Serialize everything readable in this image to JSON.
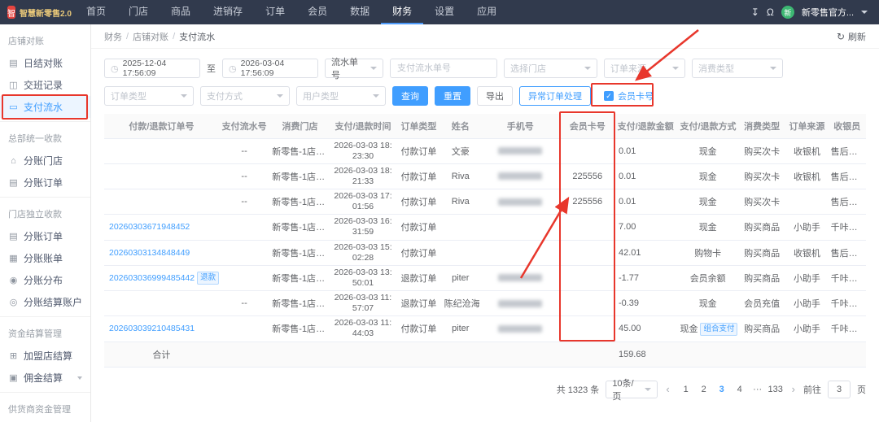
{
  "colors": {
    "accent": "#409eff",
    "topnav_bg": "#313a4d",
    "annotation": "#e8372c",
    "active_item_bg": "#ecf5ff"
  },
  "topnav": {
    "logo_text": "智慧新零售2.0",
    "items": [
      "首页",
      "门店",
      "商品",
      "进销存",
      "订单",
      "会员",
      "数据",
      "财务",
      "设置",
      "应用"
    ],
    "active": "财务",
    "avatar_text": "新",
    "user_name": "新零售官方..."
  },
  "sidebar": {
    "groups": [
      {
        "title": "店铺对账",
        "items": [
          {
            "label": "日结对账",
            "icon": "calendar-check-icon"
          },
          {
            "label": "交班记录",
            "icon": "shift-record-icon"
          },
          {
            "label": "支付流水",
            "icon": "payment-flow-icon",
            "active": true,
            "annotated": true
          }
        ]
      },
      {
        "title": "总部统一收款",
        "items": [
          {
            "label": "分账门店",
            "icon": "store-icon"
          },
          {
            "label": "分账订单",
            "icon": "order-icon"
          }
        ]
      },
      {
        "title": "门店独立收款",
        "items": [
          {
            "label": "分账订单",
            "icon": "order-icon"
          },
          {
            "label": "分账账单",
            "icon": "bill-icon"
          },
          {
            "label": "分账分布",
            "icon": "distribution-icon"
          },
          {
            "label": "分账结算账户",
            "icon": "account-icon"
          }
        ]
      },
      {
        "title": "资金结算管理",
        "items": [
          {
            "label": "加盟店结算",
            "icon": "franchise-icon"
          },
          {
            "label": "佣金结算",
            "icon": "commission-icon",
            "expandable": true
          }
        ]
      },
      {
        "title": "供货商资金管理",
        "items": []
      }
    ]
  },
  "breadcrumb": {
    "parts": [
      "财务",
      "店铺对账",
      "支付流水"
    ],
    "separator": "/",
    "refresh_label": "刷新"
  },
  "filters": {
    "date_from": "2025-12-04 17:56:09",
    "range_separator": "至",
    "date_to": "2026-03-04 17:56:09",
    "flow_no_select": "流水单号",
    "flow_no_placeholder": "支付流水单号",
    "store_placeholder": "选择门店",
    "order_source_placeholder": "订单来源",
    "consume_type_placeholder": "消费类型",
    "order_type_placeholder": "订单类型",
    "pay_method_placeholder": "支付方式",
    "user_type_placeholder": "用户类型",
    "search_label": "查询",
    "reset_label": "重置",
    "export_label": "导出",
    "abnormal_label": "异常订单处理",
    "member_card_label": "会员卡号",
    "member_card_checked": true
  },
  "table": {
    "columns": [
      "付款/退款订单号",
      "支付流水号",
      "消费门店",
      "支付/退款时间",
      "订单类型",
      "姓名",
      "手机号",
      "会员卡号",
      "支付/退款金额",
      "支付/退款方式",
      "消费类型",
      "订单来源",
      "收银员"
    ],
    "tags": {
      "refund": "退款"
    },
    "rows": [
      {
        "order": "",
        "link": false,
        "refund_tag": false,
        "flow": "--",
        "store": "新零售-1店（...",
        "time": "2026-03-03 18:23:30",
        "type": "付款订单",
        "name": "文豪",
        "phone_blurred": true,
        "card": "",
        "amount": "0.01",
        "method": "现金",
        "combo_tag": "",
        "consume": "购买次卡",
        "source": "收银机",
        "cashier": "售后小刘"
      },
      {
        "order": "",
        "link": false,
        "refund_tag": false,
        "flow": "--",
        "store": "新零售-1店（...",
        "time": "2026-03-03 18:21:33",
        "type": "付款订单",
        "name": "Riva",
        "phone_blurred": true,
        "card": "225556",
        "amount": "0.01",
        "method": "现金",
        "combo_tag": "",
        "consume": "购买次卡",
        "source": "收银机",
        "cashier": "售后小刘"
      },
      {
        "order": "",
        "link": false,
        "refund_tag": false,
        "flow": "--",
        "store": "新零售-1店（...",
        "time": "2026-03-03 17:01:56",
        "type": "付款订单",
        "name": "Riva",
        "phone_blurred": true,
        "card": "225556",
        "amount": "0.01",
        "method": "现金",
        "combo_tag": "",
        "consume": "购买次卡",
        "source": "",
        "cashier": "售后小刘"
      },
      {
        "order": "20260303671948452",
        "link": true,
        "refund_tag": false,
        "flow": "",
        "store": "新零售-1店（...",
        "time": "2026-03-03 16:31:59",
        "type": "付款订单",
        "name": "",
        "phone_blurred": false,
        "card": "",
        "amount": "7.00",
        "method": "现金",
        "combo_tag": "",
        "consume": "购买商品",
        "source": "小助手",
        "cashier": "千咔零售店..."
      },
      {
        "order": "20260303134848449",
        "link": true,
        "refund_tag": false,
        "flow": "",
        "store": "新零售-1店（...",
        "time": "2026-03-03 15:02:28",
        "type": "付款订单",
        "name": "",
        "phone_blurred": false,
        "card": "",
        "amount": "42.01",
        "method": "购物卡",
        "combo_tag": "",
        "consume": "购买商品",
        "source": "收银机",
        "cashier": "售后小刘"
      },
      {
        "order": "202603036999485442",
        "link": true,
        "refund_tag": true,
        "flow": "",
        "store": "新零售-1店（...",
        "time": "2026-03-03 13:50:01",
        "type": "退款订单",
        "name": "piter",
        "phone_blurred": true,
        "card": "",
        "amount": "-1.77",
        "method": "会员余额",
        "combo_tag": "",
        "consume": "购买商品",
        "source": "小助手",
        "cashier": "千咔零售店..."
      },
      {
        "order": "",
        "link": false,
        "refund_tag": false,
        "flow": "--",
        "store": "新零售-1店（...",
        "time": "2026-03-03 11:57:07",
        "type": "退款订单",
        "name": "陈纪沧海",
        "phone_blurred": true,
        "card": "",
        "amount": "-0.39",
        "method": "现金",
        "combo_tag": "",
        "consume": "会员充值",
        "source": "小助手",
        "cashier": "千咔零售店..."
      },
      {
        "order": "202603039210485431",
        "link": true,
        "refund_tag": false,
        "flow": "",
        "store": "新零售-1店（...",
        "time": "2026-03-03 11:44:03",
        "type": "付款订单",
        "name": "piter",
        "phone_blurred": true,
        "card": "",
        "amount": "45.00",
        "method": "现金",
        "combo_tag": "组合支付",
        "consume": "购买商品",
        "source": "小助手",
        "cashier": "千咔零售店..."
      }
    ],
    "summary": {
      "label": "合计",
      "amount": "159.68"
    }
  },
  "pagination": {
    "total_text": "共 1323 条",
    "page_size_text": "10条/页",
    "pages": [
      "1",
      "2",
      "3",
      "4",
      "···",
      "133"
    ],
    "active_page": "3",
    "goto_label": "前往",
    "goto_value": "3",
    "goto_unit": "页"
  }
}
